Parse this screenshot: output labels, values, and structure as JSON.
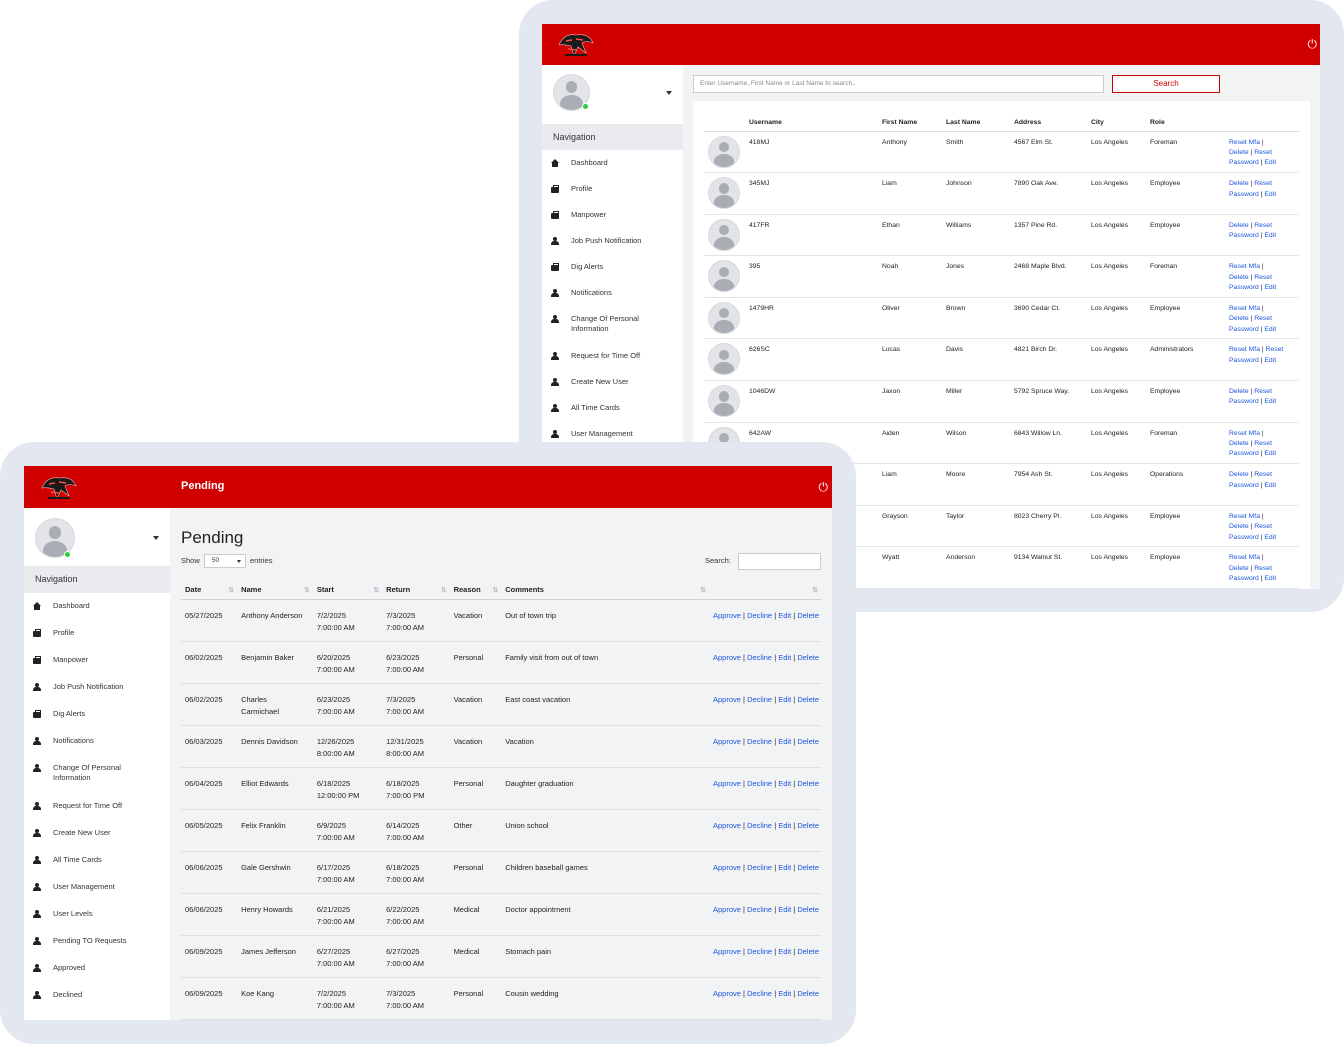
{
  "brand": {
    "accent": "#d10000",
    "link": "#1a56db",
    "logo_alt": "Tiger logo"
  },
  "icons": {
    "power": "power-icon",
    "dashboard": "home-icon",
    "profile": "briefcase-icon",
    "user": "user-icon"
  },
  "back_screen": {
    "search": {
      "placeholder": "Enter Username, First Name or Last Name to search..",
      "button": "Search"
    },
    "nav": {
      "title": "Navigation",
      "items": [
        {
          "label": "Dashboard",
          "icon": "home-icon"
        },
        {
          "label": "Profile",
          "icon": "briefcase-icon"
        },
        {
          "label": "Manpower",
          "icon": "briefcase-icon"
        },
        {
          "label": "Job Push Notification",
          "icon": "user-icon"
        },
        {
          "label": "Dig Alerts",
          "icon": "briefcase-icon"
        },
        {
          "label": "Notifications",
          "icon": "user-icon"
        },
        {
          "label": "Change Of Personal Information",
          "icon": "user-icon"
        },
        {
          "label": "Request for Time Off",
          "icon": "user-icon"
        },
        {
          "label": "Create New User",
          "icon": "user-icon"
        },
        {
          "label": "All Time Cards",
          "icon": "user-icon"
        },
        {
          "label": "User Management",
          "icon": "user-icon"
        }
      ]
    },
    "table": {
      "headers": [
        "Username",
        "First Name",
        "Last Name",
        "Address",
        "City",
        "Role"
      ],
      "rows": [
        {
          "username": "418MJ",
          "first": "Anthony",
          "last": "Smith",
          "address": "4567 Elm St.",
          "city": "Los Angeles",
          "role": "Foreman",
          "actions": "mfa"
        },
        {
          "username": "345MJ",
          "first": "Liam",
          "last": "Johnson",
          "address": "7890 Oak Ave.",
          "city": "Los Angeles",
          "role": "Employee",
          "actions": "basic"
        },
        {
          "username": "417FR",
          "first": "Ethan",
          "last": "Williams",
          "address": "1357 Pine Rd.",
          "city": "Los Angeles",
          "role": "Employee",
          "actions": "basic"
        },
        {
          "username": "395",
          "first": "Noah",
          "last": "Jones",
          "address": "2468 Maple Blvd.",
          "city": "Los Angeles",
          "role": "Foreman",
          "actions": "mfa"
        },
        {
          "username": "1479HR",
          "first": "Oliver",
          "last": "Brown",
          "address": "3690 Cedar Ct.",
          "city": "Los Angeles",
          "role": "Employee",
          "actions": "mfa"
        },
        {
          "username": "626SC",
          "first": "Lucas",
          "last": "Davis",
          "address": "4821 Birch Dr.",
          "city": "Los Angeles",
          "role": "Administrators",
          "actions": "mfa-nodelete"
        },
        {
          "username": "1046DW",
          "first": "Jaxon",
          "last": "Miller",
          "address": "5792 Spruce Way.",
          "city": "Los Angeles",
          "role": "Employee",
          "actions": "basic"
        },
        {
          "username": "642AW",
          "first": "Aiden",
          "last": "Wilson",
          "address": "6843 Willow Ln.",
          "city": "Los Angeles",
          "role": "Foreman",
          "actions": "mfa"
        },
        {
          "username": "",
          "first": "Liam",
          "last": "Moore",
          "address": "7954 Ash St.",
          "city": "Los Angeles",
          "role": "Operations",
          "actions": "basic"
        },
        {
          "username": "",
          "first": "Grayson",
          "last": "Taylor",
          "address": "8023 Cherry Pl.",
          "city": "Los Angeles",
          "role": "Employee",
          "actions": "mfa"
        },
        {
          "username": "",
          "first": "Wyatt",
          "last": "Anderson",
          "address": "9134 Walnut St.",
          "city": "Los Angeles",
          "role": "Employee",
          "actions": "mfa"
        }
      ],
      "action_labels": {
        "reset_mfa": "Reset Mfa",
        "delete": "Delete",
        "reset": "Reset",
        "password": "Password",
        "edit": "Edit",
        "sep": "|"
      }
    }
  },
  "front_screen": {
    "topbar_title": "Pending",
    "heading": "Pending",
    "show": {
      "prefix": "Show",
      "value": "50",
      "suffix": "entries"
    },
    "search_label": "Search:",
    "nav": {
      "title": "Navigation",
      "items": [
        {
          "label": "Dashboard",
          "icon": "home-icon"
        },
        {
          "label": "Profile",
          "icon": "briefcase-icon"
        },
        {
          "label": "Manpower",
          "icon": "briefcase-icon"
        },
        {
          "label": "Job Push Notification",
          "icon": "user-icon"
        },
        {
          "label": "Dig Alerts",
          "icon": "briefcase-icon"
        },
        {
          "label": "Notifications",
          "icon": "user-icon"
        },
        {
          "label": "Change Of Personal Information",
          "icon": "user-icon"
        },
        {
          "label": "Request for Time Off",
          "icon": "user-icon"
        },
        {
          "label": "Create New User",
          "icon": "user-icon"
        },
        {
          "label": "All Time Cards",
          "icon": "user-icon"
        },
        {
          "label": "User Management",
          "icon": "user-icon"
        },
        {
          "label": "User Levels",
          "icon": "user-icon"
        },
        {
          "label": "Pending TO Requests",
          "icon": "user-icon"
        },
        {
          "label": "Approved",
          "icon": "user-icon"
        },
        {
          "label": "Declined",
          "icon": "user-icon"
        }
      ]
    },
    "table": {
      "headers": [
        "Date",
        "Name",
        "Start",
        "Return",
        "Reason",
        "Comments",
        "",
        ""
      ],
      "action_labels": {
        "approve": "Approve",
        "decline": "Decline",
        "edit": "Edit",
        "delete": "Delete",
        "sep": "|"
      },
      "rows": [
        {
          "date": "05/27/2025",
          "name": "Anthony Anderson",
          "start": "7/2/2025 7:00:00 AM",
          "return": "7/3/2025 7:00:00 AM",
          "reason": "Vacation",
          "comments": "Out of town trip"
        },
        {
          "date": "06/02/2025",
          "name": "Benjamin Baker",
          "start": "6/20/2025 7:00:00 AM",
          "return": "6/23/2025 7:00:00 AM",
          "reason": "Personal",
          "comments": "Family visit from out of town"
        },
        {
          "date": "06/02/2025",
          "name": "Charles Carmichael",
          "start": "6/23/2025 7:00:00 AM",
          "return": "7/3/2025 7:00:00 AM",
          "reason": "Vacation",
          "comments": "East coast vacation"
        },
        {
          "date": "06/03/2025",
          "name": "Dennis Davidson",
          "start": "12/26/2025 8:00:00 AM",
          "return": "12/31/2025 8:00:00 AM",
          "reason": "Vacation",
          "comments": "Vacation"
        },
        {
          "date": "06/04/2025",
          "name": "Elliot Edwards",
          "start": "6/18/2025 12:00:00 PM",
          "return": "6/18/2025 7:00:00 PM",
          "reason": "Personal",
          "comments": "Daughter graduation"
        },
        {
          "date": "06/05/2025",
          "name": "Felix Franklin",
          "start": "6/9/2025 7:00:00 AM",
          "return": "6/14/2025 7:00:00 AM",
          "reason": "Other",
          "comments": "Union school"
        },
        {
          "date": "06/06/2025",
          "name": "Gale Gershwin",
          "start": "6/17/2025 7:00:00 AM",
          "return": "6/18/2025 7:00:00 AM",
          "reason": "Personal",
          "comments": "Children baseball games"
        },
        {
          "date": "06/06/2025",
          "name": "Henry Howards",
          "start": "6/21/2025 7:00:00 AM",
          "return": "6/22/2025 7:00:00 AM",
          "reason": "Medical",
          "comments": "Doctor appointment"
        },
        {
          "date": "06/09/2025",
          "name": "James Jefferson",
          "start": "6/27/2025 7:00:00 AM",
          "return": "6/27/2025 7:00:00 AM",
          "reason": "Medical",
          "comments": "Stomach pain"
        },
        {
          "date": "06/09/2025",
          "name": "Koe Kang",
          "start": "7/2/2025 7:00:00 AM",
          "return": "7/3/2025 7:00:00 AM",
          "reason": "Personal",
          "comments": "Cousin wedding"
        }
      ]
    }
  }
}
